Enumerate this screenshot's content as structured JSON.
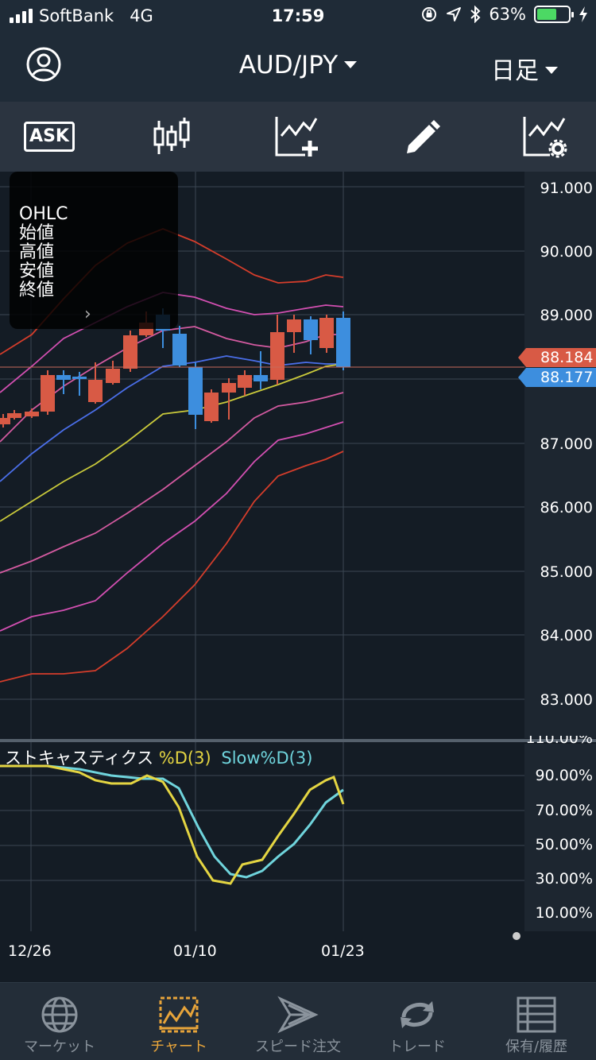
{
  "status": {
    "carrier": "SoftBank",
    "network": "4G",
    "time": "17:59",
    "battery": "63%",
    "battery_level": 0.63
  },
  "nav": {
    "pair": "AUD/JPY",
    "period": "日足"
  },
  "toolbar": {
    "ask_label": "ASK",
    "icons": [
      "candlestick-icon",
      "add-indicator-icon",
      "pencil-icon",
      "indicator-settings-icon"
    ]
  },
  "ohlc": {
    "title": "OHLC",
    "open": "始値",
    "high": "高値",
    "low": "安値",
    "close": "終値"
  },
  "price_axis": [
    "91.000",
    "90.000",
    "89.000",
    "87.000",
    "86.000",
    "85.000",
    "84.000",
    "83.000"
  ],
  "bid_price": "88.184",
  "ask_price": "88.177",
  "oscillator": {
    "name": "ストキャスティクス",
    "d_label": "%D(3)",
    "slow_label": "Slow%D(3)",
    "axis": [
      "110.00%",
      "90.00%",
      "70.00%",
      "50.00%",
      "30.00%",
      "10.00%"
    ]
  },
  "dates": [
    "12/26",
    "01/10",
    "01/23"
  ],
  "tabs": [
    {
      "label": "マーケット",
      "icon": "globe-icon"
    },
    {
      "label": "チャート",
      "icon": "chart-icon"
    },
    {
      "label": "スピード注文",
      "icon": "speed-order-icon"
    },
    {
      "label": "トレード",
      "icon": "trade-icon"
    },
    {
      "label": "保有/履歴",
      "icon": "history-icon"
    }
  ],
  "colors": {
    "up": "#d85a45",
    "down": "#3d8ede",
    "accent": "#e7a43a",
    "stoch_d": "#e4d542",
    "stoch_slow": "#6fd4dc"
  }
}
